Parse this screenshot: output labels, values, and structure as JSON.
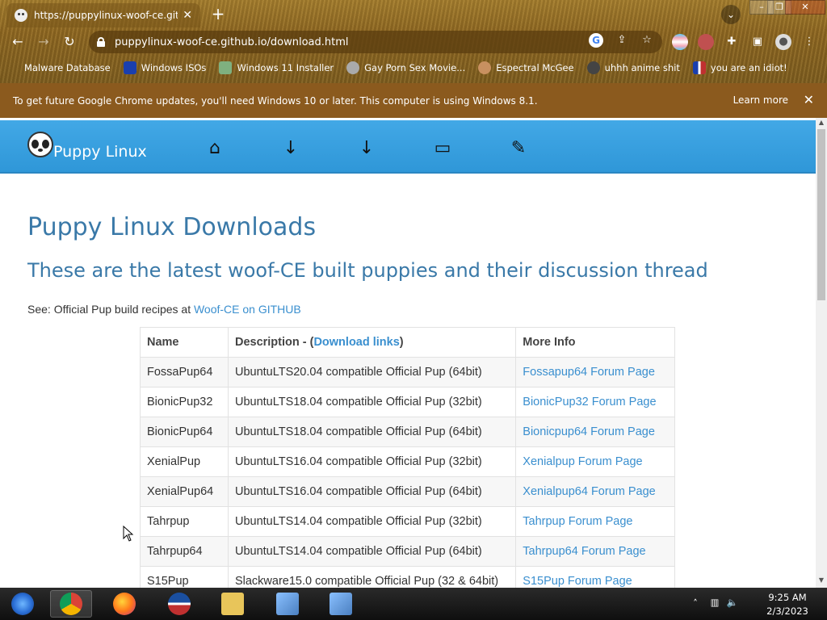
{
  "browser": {
    "tab_title": "https://puppylinux-woof-ce.github.io",
    "new_tab": "+",
    "url": "puppylinux-woof-ce.github.io/download.html",
    "bookmarks": [
      {
        "label": "Malware Database",
        "color": "#d8c08a"
      },
      {
        "label": "Windows ISOs",
        "color": "#1a3fae"
      },
      {
        "label": "Windows 11 Installer",
        "color": "#7fb07f"
      },
      {
        "label": "Gay Porn Sex Movie...",
        "color": "#aaaaaa"
      },
      {
        "label": "Espectral McGee",
        "color": "#c89060"
      },
      {
        "label": "uhhh anime shit",
        "color": "#444444"
      },
      {
        "label": "you are an idiot!",
        "color": "#c03030"
      }
    ]
  },
  "infobar": {
    "message": "To get future Google Chrome updates, you'll need Windows 10 or later. This computer is using Windows 8.1.",
    "learn_more": "Learn more",
    "close": "✕"
  },
  "site": {
    "brand": "Puppy Linux",
    "title": "Puppy Linux Downloads",
    "subtitle": "These are the latest woof-CE built puppies and their discussion thread",
    "see_prefix": "See: Official Pup build recipes at ",
    "see_link": "Woof-CE on GITHUB"
  },
  "table": {
    "headers": {
      "name": "Name",
      "desc_prefix": "Description - (",
      "desc_link": "Download links",
      "desc_suffix": ")",
      "info": "More Info"
    },
    "rows": [
      {
        "name": "FossaPup64",
        "desc": "UbuntuLTS20.04 compatible Official Pup (64bit)",
        "info": "Fossapup64 Forum Page"
      },
      {
        "name": "BionicPup32",
        "desc": "UbuntuLTS18.04 compatible Official Pup (32bit)",
        "info": "BionicPup32 Forum Page"
      },
      {
        "name": "BionicPup64",
        "desc": "UbuntuLTS18.04 compatible Official Pup (64bit)",
        "info": "Bionicpup64 Forum Page"
      },
      {
        "name": "XenialPup",
        "desc": "UbuntuLTS16.04 compatible Official Pup (32bit)",
        "info": "Xenialpup Forum Page"
      },
      {
        "name": "XenialPup64",
        "desc": "UbuntuLTS16.04 compatible Official Pup (64bit)",
        "info": "Xenialpup64 Forum Page"
      },
      {
        "name": "Tahrpup",
        "desc": "UbuntuLTS14.04 compatible Official Pup (32bit)",
        "info": "Tahrpup Forum Page"
      },
      {
        "name": "Tahrpup64",
        "desc": "UbuntuLTS14.04 compatible Official Pup (64bit)",
        "info": "Tahrpup64 Forum Page"
      },
      {
        "name": "S15Pup",
        "desc": "Slackware15.0 compatible Official Pup (32 & 64bit)",
        "info": "S15Pup Forum Page"
      }
    ]
  },
  "taskbar": {
    "apps": [
      {
        "icon": "windows-start-icon",
        "color": "#2b6fd6"
      },
      {
        "icon": "chrome-icon",
        "color": "#db4437"
      },
      {
        "icon": "firefox-icon",
        "color": "#ff7a1a"
      },
      {
        "icon": "obama-logo-icon",
        "color": "#1a4fa0"
      },
      {
        "icon": "file-explorer-icon",
        "color": "#e8c55a"
      },
      {
        "icon": "setup-icon",
        "color": "#4a7fc0"
      },
      {
        "icon": "setup-icon",
        "color": "#4a7fc0"
      }
    ],
    "time": "9:25 AM",
    "date": "2/3/2023"
  }
}
